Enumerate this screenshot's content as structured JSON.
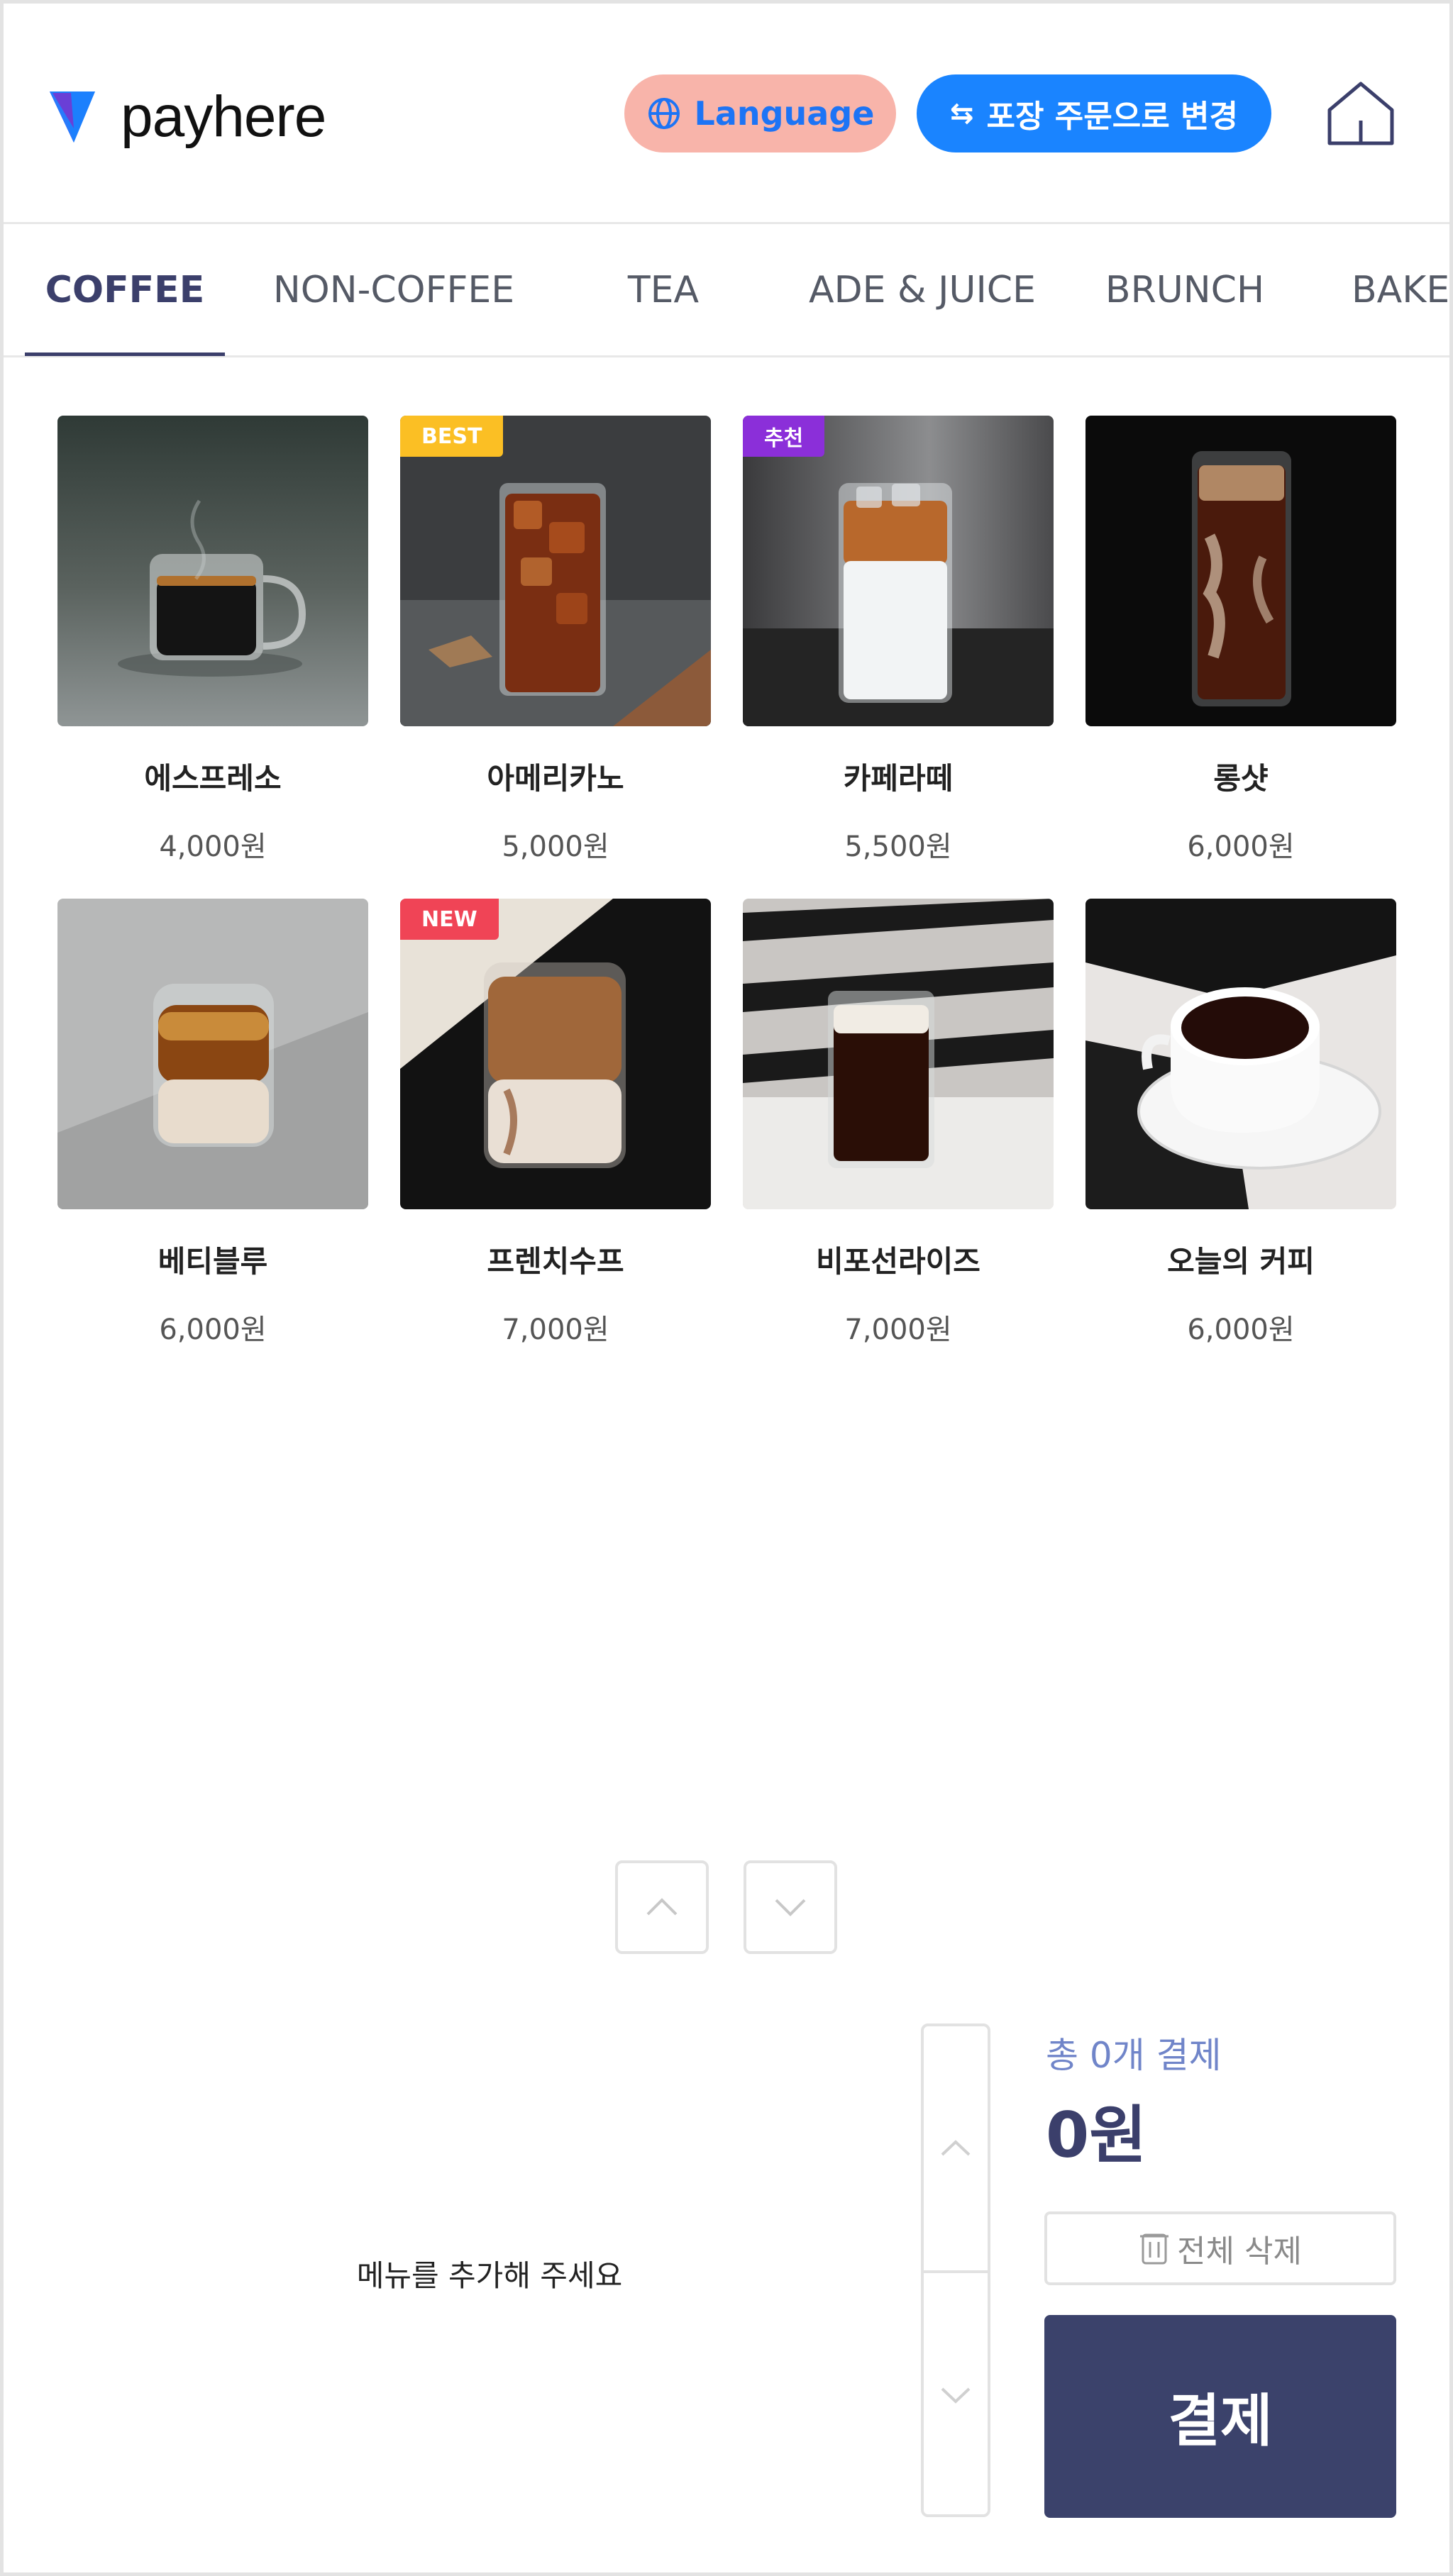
{
  "header": {
    "logo_text": "payhere",
    "language_label": "Language",
    "order_mode_label": "포장 주문으로 변경",
    "swap_glyph": "⇆"
  },
  "tabs": [
    {
      "label": "COFFEE",
      "active": true
    },
    {
      "label": "NON-COFFEE",
      "active": false
    },
    {
      "label": "TEA",
      "active": false
    },
    {
      "label": "ADE & JUICE",
      "active": false
    },
    {
      "label": "BRUNCH",
      "active": false
    },
    {
      "label": "BAKE",
      "active": false
    }
  ],
  "items": [
    {
      "name": "에스프레소",
      "price": "4,000원",
      "badge": ""
    },
    {
      "name": "아메리카노",
      "price": "5,000원",
      "badge": "BEST"
    },
    {
      "name": "카페라떼",
      "price": "5,500원",
      "badge": "추천"
    },
    {
      "name": "롱샷",
      "price": "6,000원",
      "badge": ""
    },
    {
      "name": "베티블루",
      "price": "6,000원",
      "badge": ""
    },
    {
      "name": "프렌치수프",
      "price": "7,000원",
      "badge": "NEW"
    },
    {
      "name": "비포선라이즈",
      "price": "7,000원",
      "badge": ""
    },
    {
      "name": "오늘의 커피",
      "price": "6,000원",
      "badge": ""
    }
  ],
  "cart": {
    "empty_message": "메뉴를 추가해 주세요",
    "total_label": "총 0개 결제",
    "total_amount": "0원",
    "clear_label": "전체 삭제",
    "pay_label": "결제"
  },
  "colors": {
    "brand": "#3b3f6b",
    "lang_button": "#f8b4aa",
    "order_button": "#1a84ff",
    "badge_best": "#fbbf24",
    "badge_recommend": "#8b2fd9",
    "badge_new": "#f04456"
  }
}
